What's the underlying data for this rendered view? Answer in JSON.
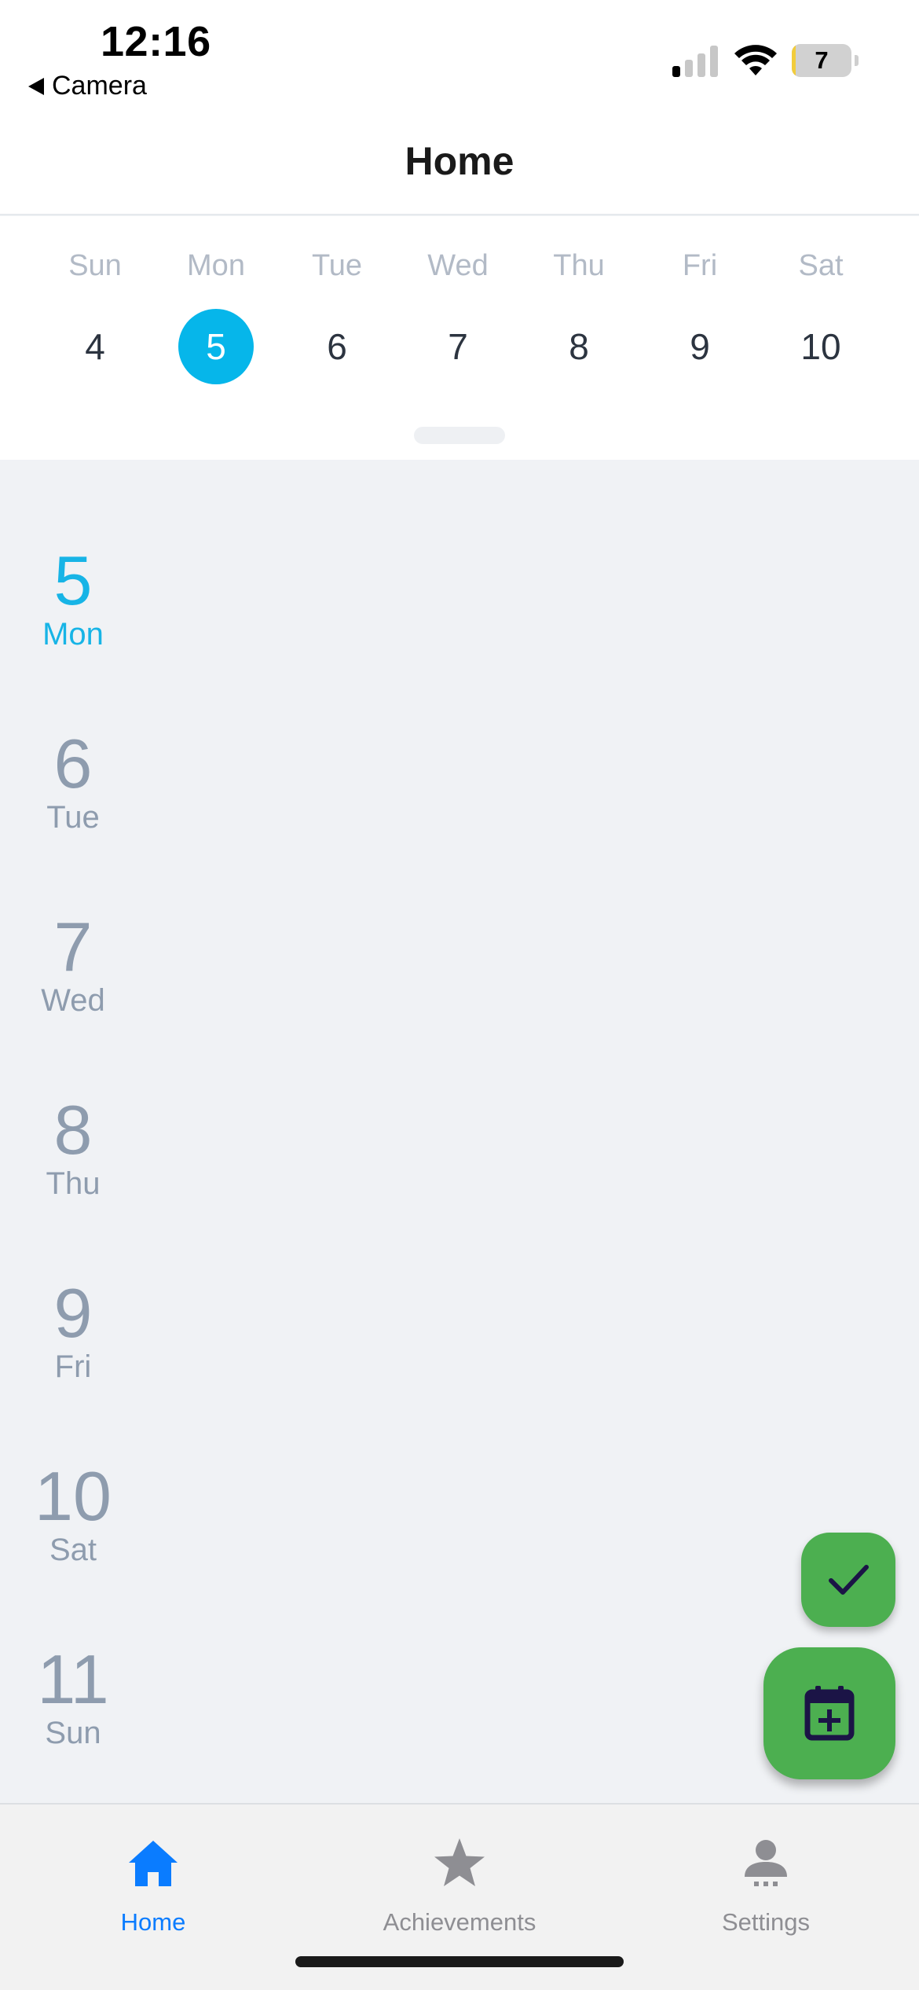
{
  "status_bar": {
    "time": "12:16",
    "back_app": "Camera",
    "battery_level": "7",
    "battery_fraction": 0.07
  },
  "header": {
    "title": "Home"
  },
  "week": {
    "days": [
      {
        "dow": "Sun",
        "num": "4",
        "selected": false
      },
      {
        "dow": "Mon",
        "num": "5",
        "selected": true
      },
      {
        "dow": "Tue",
        "num": "6",
        "selected": false
      },
      {
        "dow": "Wed",
        "num": "7",
        "selected": false
      },
      {
        "dow": "Thu",
        "num": "8",
        "selected": false
      },
      {
        "dow": "Fri",
        "num": "9",
        "selected": false
      },
      {
        "dow": "Sat",
        "num": "10",
        "selected": false
      }
    ]
  },
  "agenda": {
    "days": [
      {
        "num": "5",
        "dow": "Mon",
        "active": true
      },
      {
        "num": "6",
        "dow": "Tue",
        "active": false
      },
      {
        "num": "7",
        "dow": "Wed",
        "active": false
      },
      {
        "num": "8",
        "dow": "Thu",
        "active": false
      },
      {
        "num": "9",
        "dow": "Fri",
        "active": false
      },
      {
        "num": "10",
        "dow": "Sat",
        "active": false
      },
      {
        "num": "11",
        "dow": "Sun",
        "active": false
      }
    ]
  },
  "fab": {
    "complete_icon": "checkmark-icon",
    "add_icon": "calendar-add-icon"
  },
  "tabs": {
    "home": {
      "label": "Home",
      "icon": "house-icon",
      "active": true
    },
    "achievements": {
      "label": "Achievements",
      "icon": "star-icon",
      "active": false
    },
    "settings": {
      "label": "Settings",
      "icon": "person-icon",
      "active": false
    }
  },
  "colors": {
    "accent": "#06b6ea",
    "fab_green": "#4caf50",
    "tab_active": "#0a7cff",
    "tab_inactive": "#8e8e93",
    "background": "#f0f2f5"
  }
}
